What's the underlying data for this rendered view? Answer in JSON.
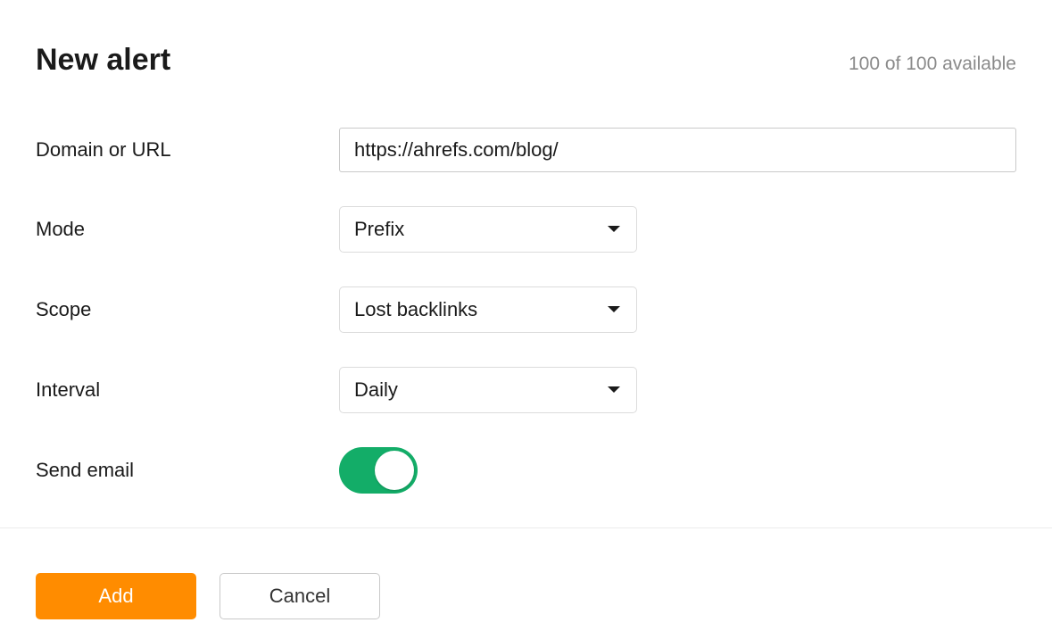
{
  "header": {
    "title": "New alert",
    "quota": "100 of 100 available"
  },
  "form": {
    "domain_label": "Domain or URL",
    "domain_value": "https://ahrefs.com/blog/",
    "mode_label": "Mode",
    "mode_value": "Prefix",
    "scope_label": "Scope",
    "scope_value": "Lost backlinks",
    "interval_label": "Interval",
    "interval_value": "Daily",
    "send_email_label": "Send email",
    "send_email_on": true
  },
  "footer": {
    "add_label": "Add",
    "cancel_label": "Cancel"
  },
  "colors": {
    "accent": "#ff8c00",
    "toggle_on": "#13ad68"
  }
}
